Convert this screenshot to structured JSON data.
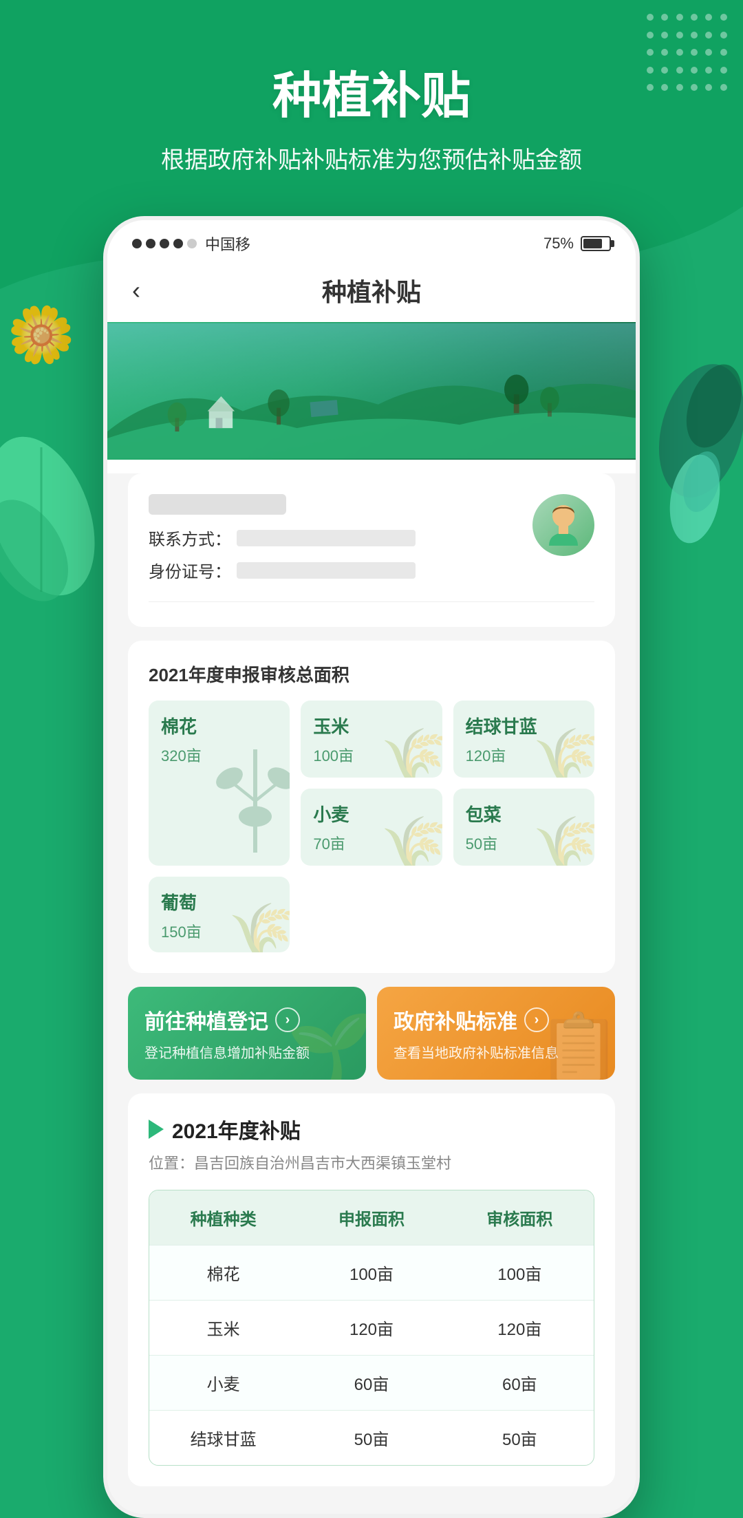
{
  "page": {
    "title": "种植补贴",
    "subtitle": "根据政府补贴补贴标准为您预估补贴金额"
  },
  "statusBar": {
    "carrier": "中国移",
    "battery": "75%",
    "signal": [
      "filled",
      "filled",
      "filled",
      "filled",
      "empty",
      "empty"
    ]
  },
  "nav": {
    "backIcon": "‹",
    "title": "种植补贴"
  },
  "userCard": {
    "contactLabel": "联系方式：",
    "idLabel": "身份证号："
  },
  "areaSection": {
    "title": "2021年度申报审核总面积",
    "crops": [
      {
        "name": "棉花",
        "area": "320亩",
        "large": true
      },
      {
        "name": "玉米",
        "area": "100亩",
        "large": false
      },
      {
        "name": "结球甘蓝",
        "area": "120亩",
        "large": false
      },
      {
        "name": "小麦",
        "area": "70亩",
        "large": false
      },
      {
        "name": "包菜",
        "area": "50亩",
        "large": false
      },
      {
        "name": "葡萄",
        "area": "150亩",
        "large": false
      }
    ]
  },
  "actionButtons": [
    {
      "title": "前往种植登记",
      "subtitle": "登记种植信息增加补贴金额",
      "type": "green",
      "arrow": ">"
    },
    {
      "title": "政府补贴标准",
      "subtitle": "查看当地政府补贴标准信息",
      "type": "orange",
      "arrow": ">"
    }
  ],
  "subsidySection": {
    "title": "2021年度补贴",
    "location": "位置：昌吉回族自治州昌吉市大西渠镇玉堂村",
    "tableHeaders": [
      "种植种类",
      "申报面积",
      "审核面积"
    ],
    "tableRows": [
      {
        "crop": "棉花",
        "reported": "100亩",
        "verified": "100亩"
      },
      {
        "crop": "玉米",
        "reported": "120亩",
        "verified": "120亩"
      },
      {
        "crop": "小麦",
        "reported": "60亩",
        "verified": "60亩"
      },
      {
        "crop": "结球甘蓝",
        "reported": "50亩",
        "verified": "50亩"
      }
    ]
  }
}
